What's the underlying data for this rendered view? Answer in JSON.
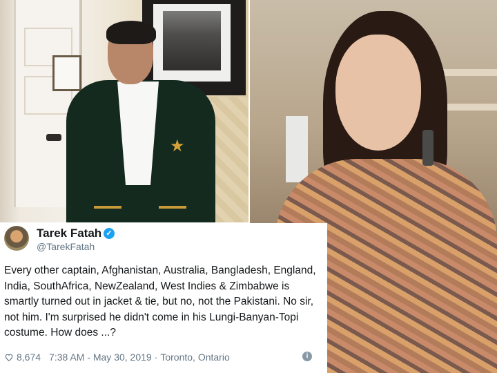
{
  "tweet": {
    "display_name": "Tarek Fatah",
    "handle": "@TarekFatah",
    "text": "Every other captain, Afghanistan, Australia, Bangladesh, England, India, SouthAfrica, NewZealand, West Indies & Zimbabwe is smartly turned out in jacket & tie, but no, not the Pakistani. No sir, not him. I'm surprised he didn't come in his Lungi-Banyan-Topi costume. How does ...?",
    "likes": "8,674",
    "timestamp": "7:38 AM - May 30, 2019",
    "separator": "·",
    "location": "Toronto, Ontario",
    "icons": {
      "verified": "verified-badge-icon",
      "like": "heart-icon",
      "info": "info-icon"
    },
    "colors": {
      "verified": "#1da1f2",
      "meta_text": "#657786",
      "text": "#14171a"
    }
  }
}
